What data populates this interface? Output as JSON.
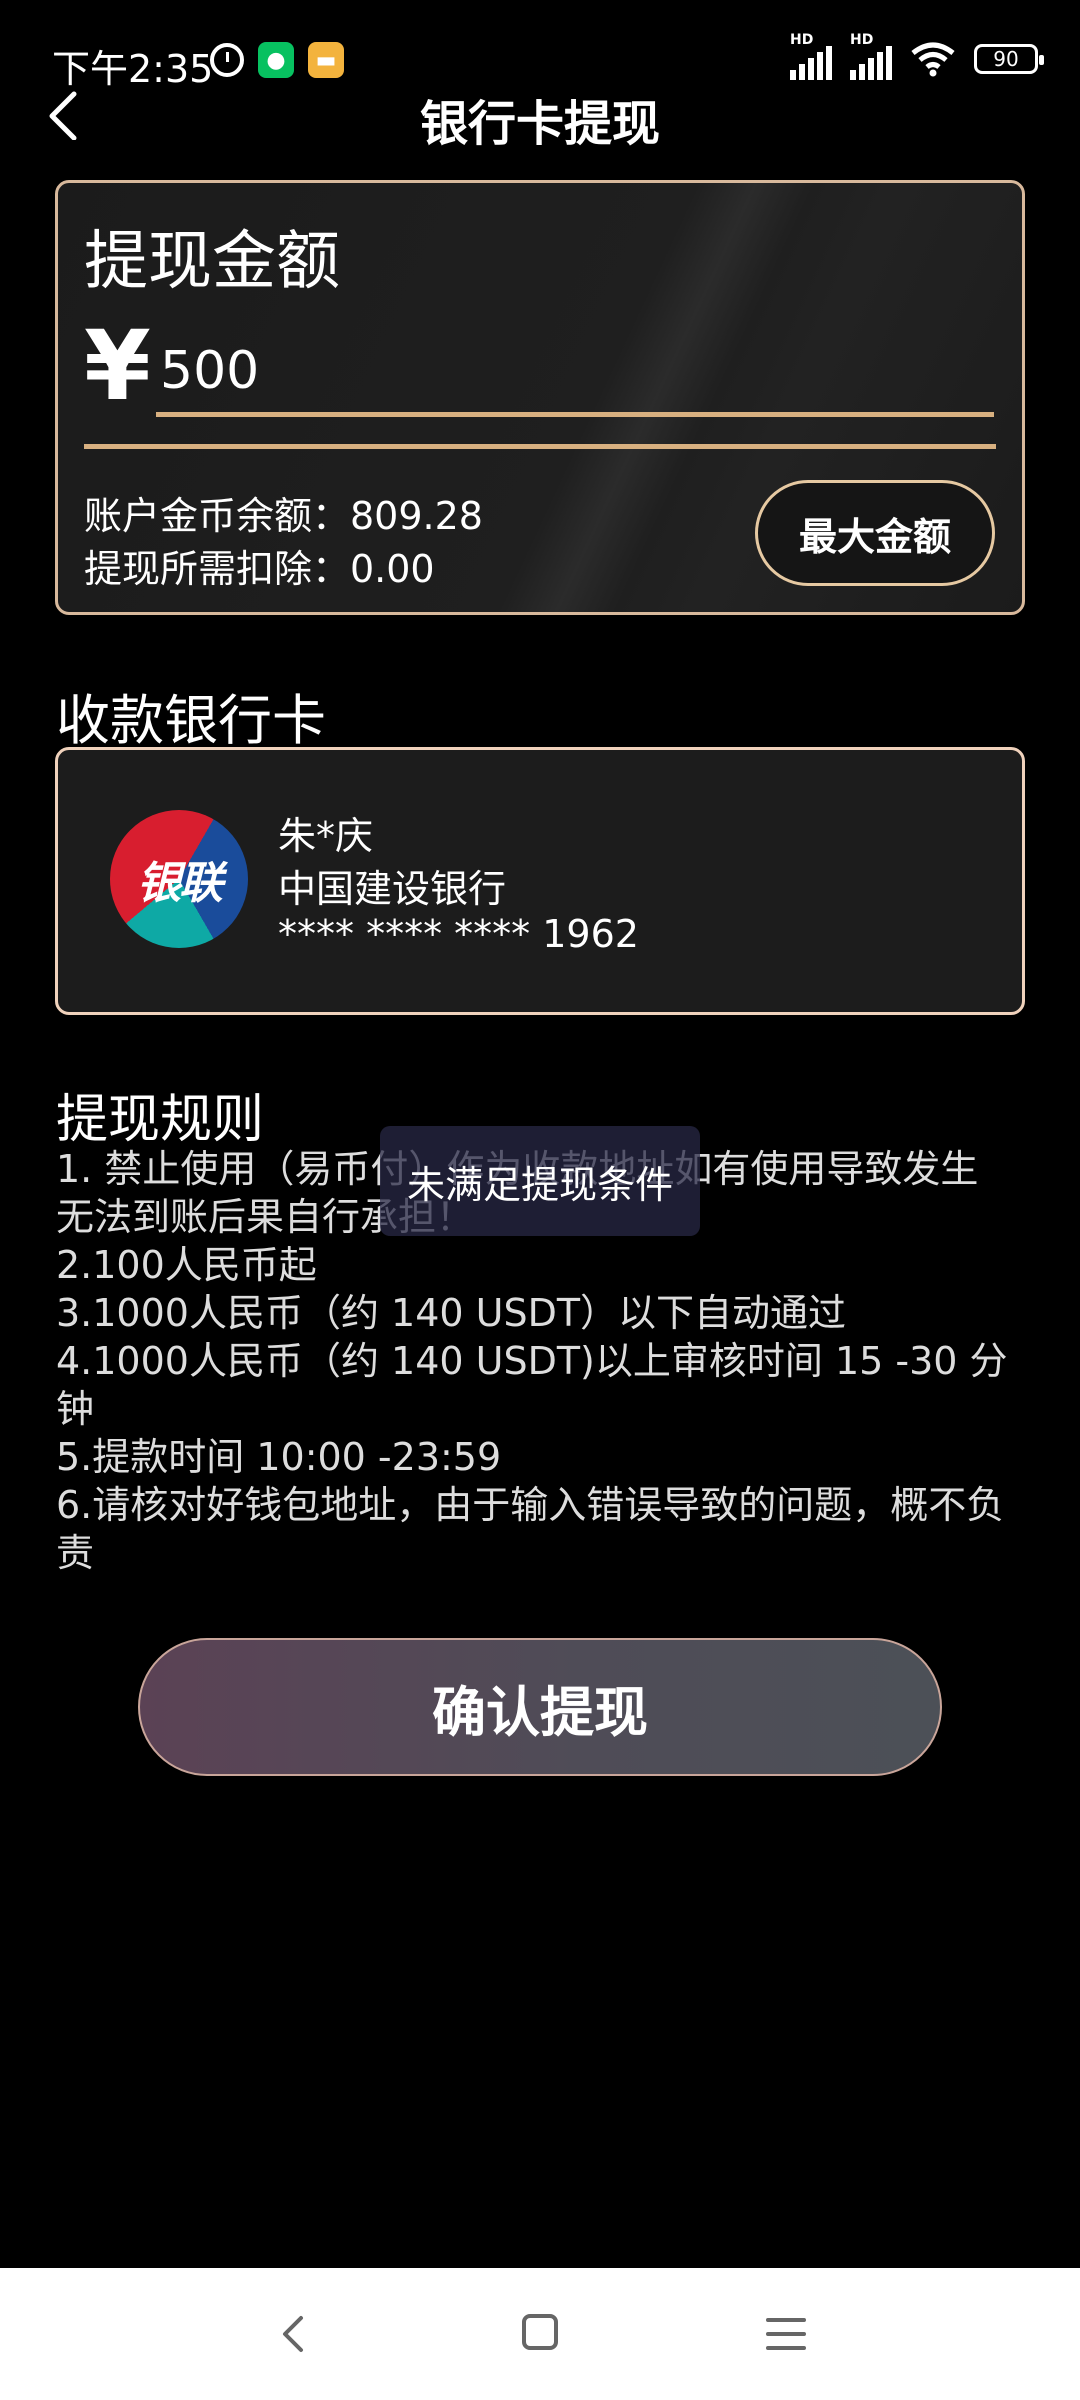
{
  "status": {
    "time": "下午2:35",
    "battery": "90",
    "hd": "HD"
  },
  "header": {
    "title": "银行卡提现"
  },
  "amount_card": {
    "title": "提现金额",
    "currency_symbol": "¥",
    "amount_value": "500",
    "balance_text": "账户金币余额：809.28",
    "deduction_text": "提现所需扣除：0.00",
    "max_button_label": "最大金额"
  },
  "bank_section": {
    "label": "收款银行卡",
    "logo_text": "银联",
    "holder": "朱*庆",
    "bank_name": "中国建设银行",
    "card_number": "**** **** **** 1962"
  },
  "rules": {
    "title": "提现规则",
    "items": [
      "1. 禁止使用（易币付）作为收款地址如有使用导致发生无法到账后果自行承担！",
      "2.100人民币起",
      "3.1000人民币（约 140 USDT）以下自动通过",
      "4.1000人民币（约 140 USDT)以上审核时间 15 -30 分钟",
      "5.提款时间 10:00 -23:59",
      "6.请核对好钱包地址，由于输入错误导致的问题，概不负责"
    ]
  },
  "toast": {
    "message": "未满足提现条件"
  },
  "confirm_button": {
    "label": "确认提现"
  },
  "icons": {
    "back": "chevron-left-icon",
    "alarm": "alarm-icon",
    "wechat": "wechat-icon",
    "note": "notes-icon",
    "signal": "signal-icon",
    "wifi": "wifi-icon",
    "battery": "battery-icon"
  }
}
